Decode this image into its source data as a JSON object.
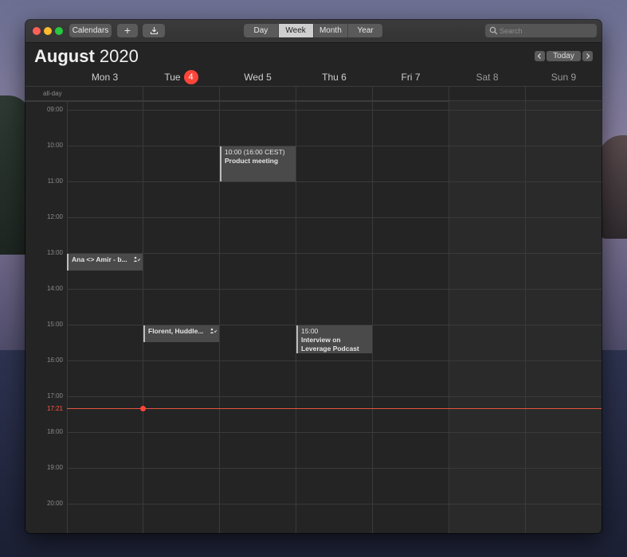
{
  "toolbar": {
    "calendars_label": "Calendars",
    "add_label": "+",
    "import_icon": "download-tray-icon",
    "view_tabs": [
      {
        "label": "Day",
        "active": false
      },
      {
        "label": "Week",
        "active": true
      },
      {
        "label": "Month",
        "active": false
      },
      {
        "label": "Year",
        "active": false
      }
    ],
    "search_placeholder": "Search"
  },
  "header": {
    "month": "August",
    "year": "2020",
    "prev_label": "‹",
    "today_label": "Today",
    "next_label": "›"
  },
  "days": [
    {
      "name": "Mon",
      "date": "3",
      "weekend": false,
      "today": false
    },
    {
      "name": "Tue",
      "date": "4",
      "weekend": false,
      "today": true
    },
    {
      "name": "Wed",
      "date": "5",
      "weekend": false,
      "today": false
    },
    {
      "name": "Thu",
      "date": "6",
      "weekend": false,
      "today": false
    },
    {
      "name": "Fri",
      "date": "7",
      "weekend": false,
      "today": false
    },
    {
      "name": "Sat",
      "date": "8",
      "weekend": true,
      "today": false
    },
    {
      "name": "Sun",
      "date": "9",
      "weekend": true,
      "today": false
    }
  ],
  "allday_label": "all-day",
  "hours": [
    "09:00",
    "10:00",
    "11:00",
    "12:00",
    "13:00",
    "14:00",
    "15:00",
    "16:00",
    "17:00",
    "18:00",
    "19:00",
    "20:00"
  ],
  "now": {
    "label": "17:21"
  },
  "events": [
    {
      "day": 2,
      "time": "10:00 (16:00 CEST)",
      "title": "Product meeting"
    },
    {
      "day": 0,
      "title": "Ana <> Amir - b...",
      "has_attendees": true
    },
    {
      "day": 1,
      "title": "Florent, Huddle...",
      "has_attendees": true
    },
    {
      "day": 3,
      "time": "15:00",
      "title": "Interview on Leverage Podcast"
    }
  ],
  "colors": {
    "today_badge": "#fe453a",
    "now_line": "#e5533f",
    "window_bg": "#242424"
  }
}
